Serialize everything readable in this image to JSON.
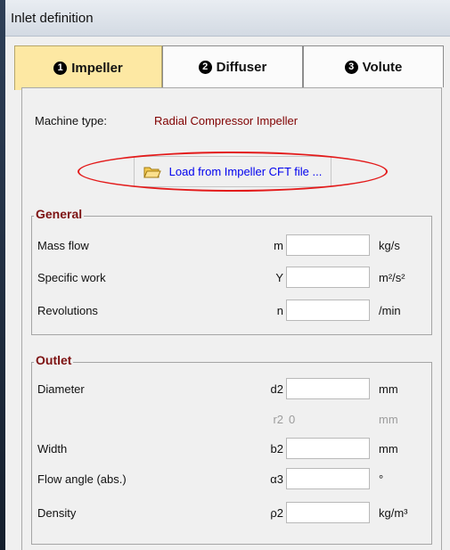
{
  "window": {
    "title": "Inlet definition"
  },
  "tabs": [
    {
      "num": "1",
      "label": "Impeller",
      "active": true
    },
    {
      "num": "2",
      "label": "Diffuser",
      "active": false
    },
    {
      "num": "3",
      "label": "Volute",
      "active": false
    }
  ],
  "machine": {
    "label": "Machine type:",
    "value": "Radial Compressor Impeller"
  },
  "load_button": {
    "label": "Load from Impeller CFT file ...",
    "icon": "folder-open-icon"
  },
  "general": {
    "title": "General",
    "rows": [
      {
        "label": "Mass flow",
        "symbol": "m",
        "value": "",
        "unit": "kg/s"
      },
      {
        "label": "Specific work",
        "symbol": "Y",
        "value": "",
        "unit": "m²/s²"
      },
      {
        "label": "Revolutions",
        "symbol": "n",
        "value": "",
        "unit": "/min"
      }
    ]
  },
  "outlet": {
    "title": "Outlet",
    "rows": [
      {
        "label": "Diameter",
        "symbol": "d2",
        "value": "",
        "unit": "mm"
      },
      {
        "label": "",
        "symbol": "r2",
        "value": "0",
        "unit": "mm",
        "disabled": true
      },
      {
        "label": "Width",
        "symbol": "b2",
        "value": "",
        "unit": "mm"
      },
      {
        "label": "Flow angle (abs.)",
        "symbol": "α3",
        "value": "",
        "unit": "°"
      },
      {
        "label": "Density",
        "symbol": "ρ2",
        "value": "",
        "unit": "kg/m³"
      }
    ]
  },
  "colors": {
    "active_tab": "#fde8a3",
    "group_title": "#7d1212",
    "machine_value": "#800000",
    "link": "#0000ee",
    "highlight_oval": "#e31b1b"
  }
}
